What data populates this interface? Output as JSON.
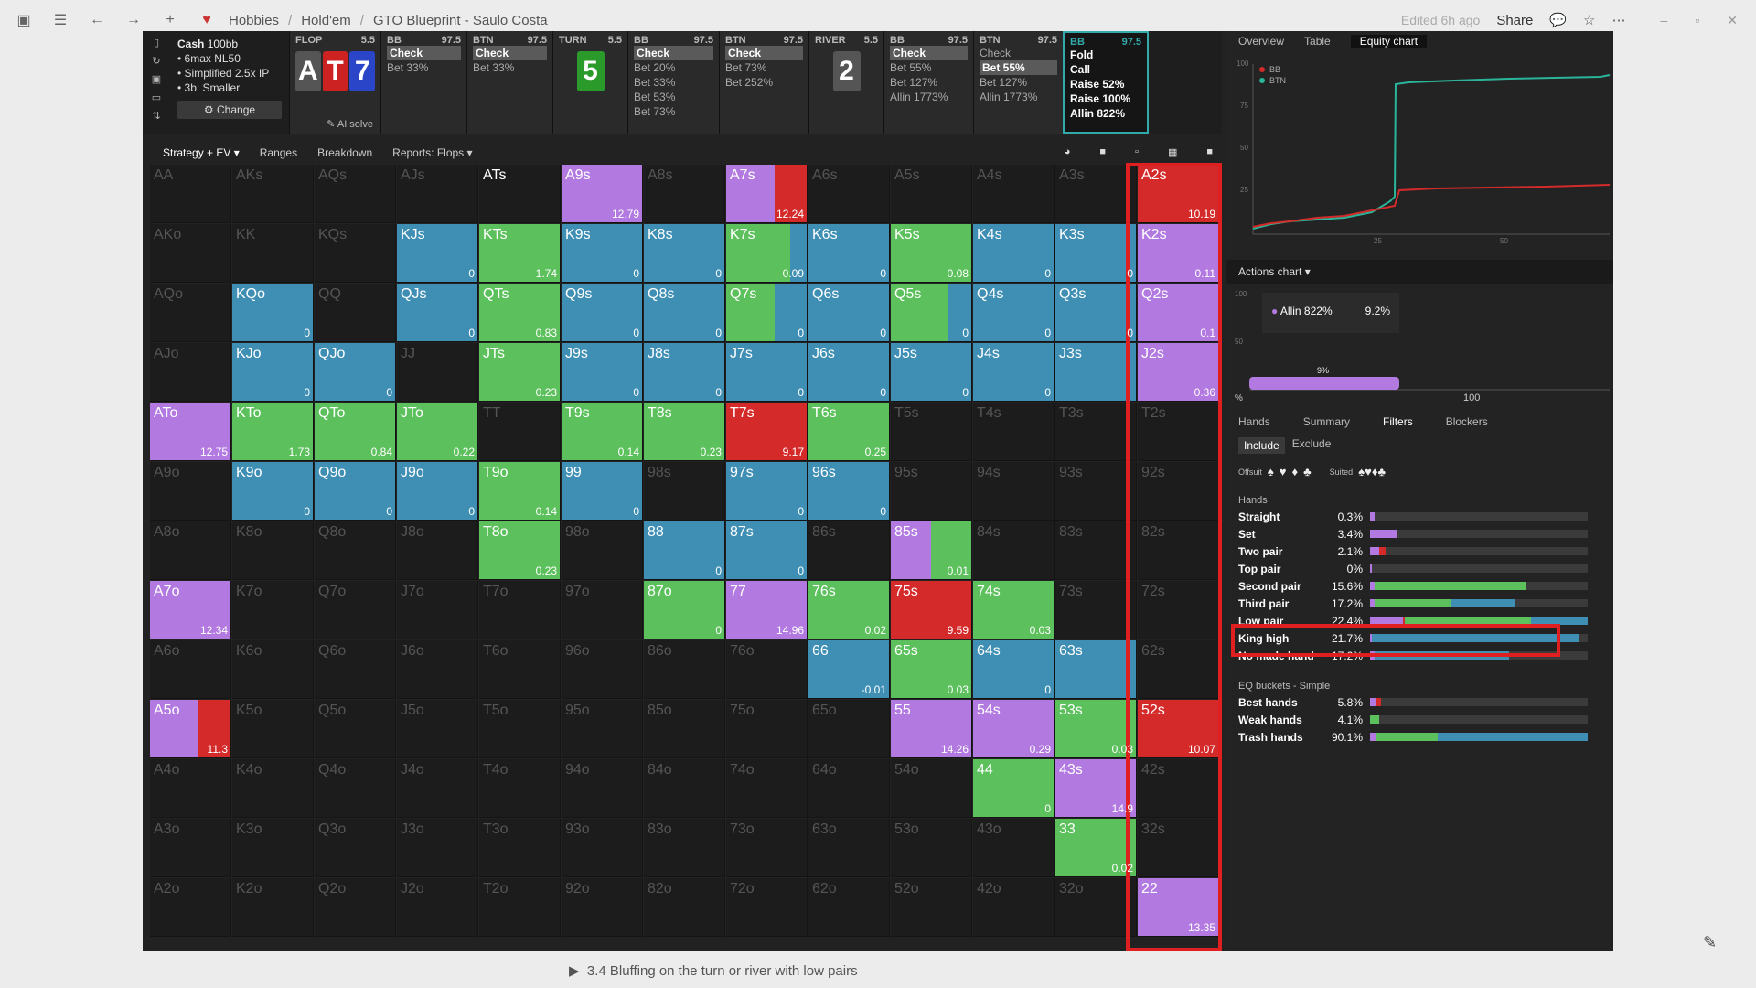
{
  "topbar": {
    "crumbs": [
      "Hobbies",
      "Hold'em",
      "GTO Blueprint - Saulo Costa"
    ],
    "edited": "Edited 6h ago",
    "share": "Share"
  },
  "info": {
    "cash": "Cash",
    "stack": "100bb",
    "lines": [
      "• 6max NL50",
      "• Simplified 2.5x IP",
      "• 3b: Smaller"
    ],
    "change_label": "Change",
    "ai_solve": "AI solve"
  },
  "flop": {
    "label": "FLOP",
    "pot": "5.5",
    "cards": [
      "A",
      "T",
      "7"
    ]
  },
  "turn": {
    "label": "TURN",
    "pot": "5.5",
    "card": "5"
  },
  "river": {
    "label": "RIVER",
    "pot": "5.5",
    "card": "2"
  },
  "blocks": [
    {
      "pos": "BB",
      "stack": "97.5",
      "lines": [
        "Check",
        "Bet 33%"
      ],
      "sel": 0
    },
    {
      "pos": "BTN",
      "stack": "97.5",
      "lines": [
        "Check",
        "Bet 33%"
      ],
      "sel": 0
    },
    {
      "pos": "BB",
      "stack": "97.5",
      "lines": [
        "Check",
        "Bet 20%",
        "Bet 33%",
        "Bet 53%",
        "Bet 73%"
      ],
      "sel": 0
    },
    {
      "pos": "BTN",
      "stack": "97.5",
      "lines": [
        "Check",
        "Bet 73%",
        "Bet 252%"
      ],
      "sel": 0
    },
    {
      "pos": "BB",
      "stack": "97.5",
      "lines": [
        "Check",
        "Bet 55%",
        "Bet 127%",
        "Allin 1773%"
      ],
      "sel": 0
    },
    {
      "pos": "BTN",
      "stack": "97.5",
      "lines": [
        "Check",
        "Bet 55%",
        "Bet 127%",
        "Allin 1773%"
      ],
      "sel": 1
    },
    {
      "pos": "BB",
      "stack": "97.5",
      "lines": [
        "Fold",
        "Call",
        "Raise 52%",
        "Raise 100%",
        "Allin 822%"
      ],
      "sel": -1
    }
  ],
  "tabs": [
    "Strategy + EV ▾",
    "Ranges",
    "Breakdown",
    "Reports: Flops ▾"
  ],
  "colors": {
    "green": "#5cc05c",
    "blue": "#3f8fb5",
    "purple": "#b27ae0",
    "red": "#d42a2a"
  },
  "grid": {
    "ranks": [
      "A",
      "K",
      "Q",
      "J",
      "T",
      "9",
      "8",
      "7",
      "6",
      "5",
      "4",
      "3",
      "2"
    ],
    "cells": {
      "ATs": {
        "ev": "",
        "mix": [
          [
            "purple",
            0.0
          ]
        ]
      },
      "A9s": {
        "ev": "12.79"
      },
      "A7s": {
        "ev": "12.24"
      },
      "A2s": {
        "ev": "10.19"
      },
      "KJs": {
        "ev": "0"
      },
      "KTs": {
        "ev": "1.74"
      },
      "K9s": {
        "ev": "0"
      },
      "K8s": {
        "ev": "0"
      },
      "K7s": {
        "ev": "0.09"
      },
      "K6s": {
        "ev": "0"
      },
      "K5s": {
        "ev": "0.08"
      },
      "K4s": {
        "ev": "0"
      },
      "K3s": {
        "ev": "0"
      },
      "K2s": {
        "ev": "0.11"
      },
      "KQo": {
        "ev": "0"
      },
      "QJs": {
        "ev": "0"
      },
      "QTs": {
        "ev": "0.83"
      },
      "Q9s": {
        "ev": "0"
      },
      "Q8s": {
        "ev": "0"
      },
      "Q7s": {
        "ev": "0"
      },
      "Q6s": {
        "ev": "0"
      },
      "Q5s": {
        "ev": "0"
      },
      "Q4s": {
        "ev": "0"
      },
      "Q3s": {
        "ev": "0"
      },
      "Q2s": {
        "ev": "0.1"
      },
      "KJo": {
        "ev": "0"
      },
      "QJo": {
        "ev": "0"
      },
      "JTs": {
        "ev": "0.23"
      },
      "J9s": {
        "ev": "0"
      },
      "J8s": {
        "ev": "0"
      },
      "J7s": {
        "ev": "0"
      },
      "J6s": {
        "ev": "0"
      },
      "J5s": {
        "ev": "0"
      },
      "J4s": {
        "ev": "0"
      },
      "J3s": {
        "ev": ""
      },
      "J2s": {
        "ev": "0.36"
      },
      "ATo": {
        "ev": "12.75"
      },
      "KTo": {
        "ev": "1.73"
      },
      "QTo": {
        "ev": "0.84"
      },
      "JTo": {
        "ev": "0.22"
      },
      "T9s": {
        "ev": "0.14"
      },
      "T8s": {
        "ev": "0.23"
      },
      "T7s": {
        "ev": "9.17"
      },
      "T6s": {
        "ev": "0.25"
      },
      "K9o": {
        "ev": "0"
      },
      "Q9o": {
        "ev": "0"
      },
      "J9o": {
        "ev": "0"
      },
      "T9o": {
        "ev": "0.14"
      },
      "99": {
        "ev": "0"
      },
      "97s": {
        "ev": "0"
      },
      "96s": {
        "ev": "0"
      },
      "T8o": {
        "ev": "0.23"
      },
      "88": {
        "ev": "0"
      },
      "87s": {
        "ev": "0"
      },
      "85s": {
        "ev": "0.01"
      },
      "A7o": {
        "ev": "12.34"
      },
      "87o": {
        "ev": "0"
      },
      "77": {
        "ev": "14.96"
      },
      "76s": {
        "ev": "0.02"
      },
      "75s": {
        "ev": "9.59"
      },
      "74s": {
        "ev": "0.03"
      },
      "66": {
        "ev": "-0.01"
      },
      "65s": {
        "ev": "0.03"
      },
      "64s": {
        "ev": "0"
      },
      "63s": {
        "ev": ""
      },
      "A5o": {
        "ev": "11.3"
      },
      "55": {
        "ev": "14.26"
      },
      "54s": {
        "ev": "0.29"
      },
      "53s": {
        "ev": "0.03"
      },
      "52s": {
        "ev": "10.07"
      },
      "44": {
        "ev": "0"
      },
      "43s": {
        "ev": "14.9"
      },
      "33": {
        "ev": "0.02"
      },
      "22": {
        "ev": "13.35"
      }
    }
  },
  "right": {
    "tabs": [
      "Overview",
      "Table",
      "Equity chart"
    ],
    "legend": [
      "BB",
      "BTN"
    ],
    "eq_ticks_y": [
      "100",
      "75",
      "50",
      "25"
    ],
    "eq_ticks_x": [
      "25",
      "50"
    ],
    "actions_label": "Actions chart",
    "tooltip_action": "Allin 822%",
    "tooltip_pct": "9.2%",
    "bar_label": "9%",
    "ac_ticks_y": [
      "100",
      "50"
    ],
    "ac_x": [
      "%",
      "100"
    ],
    "subtabs": [
      "Hands",
      "Summary",
      "Filters",
      "Blockers"
    ],
    "include": "Include",
    "exclude": "Exclude",
    "offsuit": "Offsuit",
    "suited": "Suited",
    "hands_title": "Hands",
    "hands": [
      {
        "name": "Straight",
        "pct": "0.3%",
        "mix": [
          [
            "purple",
            0.02
          ],
          [
            "blue",
            0.0
          ]
        ]
      },
      {
        "name": "Set",
        "pct": "3.4%",
        "mix": [
          [
            "purple",
            0.12
          ]
        ]
      },
      {
        "name": "Two pair",
        "pct": "2.1%",
        "mix": [
          [
            "purple",
            0.04
          ],
          [
            "red",
            0.03
          ]
        ]
      },
      {
        "name": "Top pair",
        "pct": "0%",
        "mix": [
          [
            "purple",
            0.01
          ]
        ]
      },
      {
        "name": "Second pair",
        "pct": "15.6%",
        "mix": [
          [
            "purple",
            0.02
          ],
          [
            "green",
            0.7
          ]
        ]
      },
      {
        "name": "Third pair",
        "pct": "17.2%",
        "mix": [
          [
            "purple",
            0.02
          ],
          [
            "green",
            0.35
          ],
          [
            "blue",
            0.3
          ]
        ]
      },
      {
        "name": "Low pair",
        "pct": "22.4%",
        "mix": [
          [
            "purple",
            0.15
          ],
          [
            "red",
            0.01
          ],
          [
            "green",
            0.58
          ],
          [
            "blue",
            0.26
          ]
        ]
      },
      {
        "name": "King high",
        "pct": "21.7%",
        "mix": [
          [
            "purple",
            0.01
          ],
          [
            "blue",
            0.95
          ]
        ]
      },
      {
        "name": "No made hand",
        "pct": "17.2%",
        "mix": [
          [
            "purple",
            0.02
          ],
          [
            "blue",
            0.62
          ]
        ]
      }
    ],
    "eq_title": "EQ buckets - Simple",
    "eq": [
      {
        "name": "Best hands",
        "pct": "5.8%",
        "mix": [
          [
            "purple",
            0.03
          ],
          [
            "red",
            0.02
          ]
        ]
      },
      {
        "name": "Weak hands",
        "pct": "4.1%",
        "mix": [
          [
            "green",
            0.04
          ]
        ]
      },
      {
        "name": "Trash hands",
        "pct": "90.1%",
        "mix": [
          [
            "purple",
            0.03
          ],
          [
            "green",
            0.28
          ],
          [
            "blue",
            0.69
          ]
        ]
      }
    ]
  },
  "caption": "3.4 Bluffing on the turn or river with low pairs"
}
